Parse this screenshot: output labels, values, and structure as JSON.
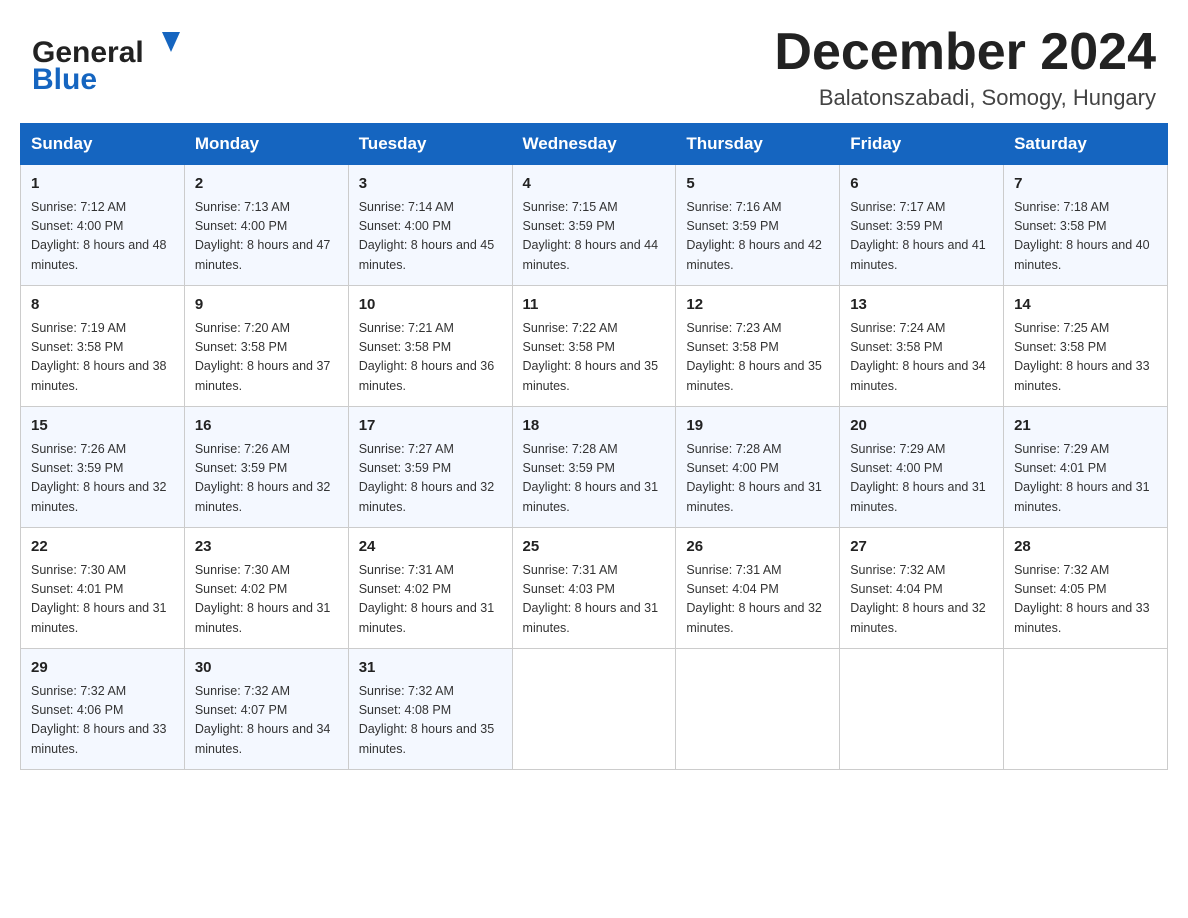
{
  "header": {
    "logo_general": "General",
    "logo_blue": "Blue",
    "month_title": "December 2024",
    "location": "Balatonszabadi, Somogy, Hungary"
  },
  "weekdays": [
    "Sunday",
    "Monday",
    "Tuesday",
    "Wednesday",
    "Thursday",
    "Friday",
    "Saturday"
  ],
  "weeks": [
    [
      {
        "day": "1",
        "sunrise": "7:12 AM",
        "sunset": "4:00 PM",
        "daylight": "8 hours and 48 minutes."
      },
      {
        "day": "2",
        "sunrise": "7:13 AM",
        "sunset": "4:00 PM",
        "daylight": "8 hours and 47 minutes."
      },
      {
        "day": "3",
        "sunrise": "7:14 AM",
        "sunset": "4:00 PM",
        "daylight": "8 hours and 45 minutes."
      },
      {
        "day": "4",
        "sunrise": "7:15 AM",
        "sunset": "3:59 PM",
        "daylight": "8 hours and 44 minutes."
      },
      {
        "day": "5",
        "sunrise": "7:16 AM",
        "sunset": "3:59 PM",
        "daylight": "8 hours and 42 minutes."
      },
      {
        "day": "6",
        "sunrise": "7:17 AM",
        "sunset": "3:59 PM",
        "daylight": "8 hours and 41 minutes."
      },
      {
        "day": "7",
        "sunrise": "7:18 AM",
        "sunset": "3:58 PM",
        "daylight": "8 hours and 40 minutes."
      }
    ],
    [
      {
        "day": "8",
        "sunrise": "7:19 AM",
        "sunset": "3:58 PM",
        "daylight": "8 hours and 38 minutes."
      },
      {
        "day": "9",
        "sunrise": "7:20 AM",
        "sunset": "3:58 PM",
        "daylight": "8 hours and 37 minutes."
      },
      {
        "day": "10",
        "sunrise": "7:21 AM",
        "sunset": "3:58 PM",
        "daylight": "8 hours and 36 minutes."
      },
      {
        "day": "11",
        "sunrise": "7:22 AM",
        "sunset": "3:58 PM",
        "daylight": "8 hours and 35 minutes."
      },
      {
        "day": "12",
        "sunrise": "7:23 AM",
        "sunset": "3:58 PM",
        "daylight": "8 hours and 35 minutes."
      },
      {
        "day": "13",
        "sunrise": "7:24 AM",
        "sunset": "3:58 PM",
        "daylight": "8 hours and 34 minutes."
      },
      {
        "day": "14",
        "sunrise": "7:25 AM",
        "sunset": "3:58 PM",
        "daylight": "8 hours and 33 minutes."
      }
    ],
    [
      {
        "day": "15",
        "sunrise": "7:26 AM",
        "sunset": "3:59 PM",
        "daylight": "8 hours and 32 minutes."
      },
      {
        "day": "16",
        "sunrise": "7:26 AM",
        "sunset": "3:59 PM",
        "daylight": "8 hours and 32 minutes."
      },
      {
        "day": "17",
        "sunrise": "7:27 AM",
        "sunset": "3:59 PM",
        "daylight": "8 hours and 32 minutes."
      },
      {
        "day": "18",
        "sunrise": "7:28 AM",
        "sunset": "3:59 PM",
        "daylight": "8 hours and 31 minutes."
      },
      {
        "day": "19",
        "sunrise": "7:28 AM",
        "sunset": "4:00 PM",
        "daylight": "8 hours and 31 minutes."
      },
      {
        "day": "20",
        "sunrise": "7:29 AM",
        "sunset": "4:00 PM",
        "daylight": "8 hours and 31 minutes."
      },
      {
        "day": "21",
        "sunrise": "7:29 AM",
        "sunset": "4:01 PM",
        "daylight": "8 hours and 31 minutes."
      }
    ],
    [
      {
        "day": "22",
        "sunrise": "7:30 AM",
        "sunset": "4:01 PM",
        "daylight": "8 hours and 31 minutes."
      },
      {
        "day": "23",
        "sunrise": "7:30 AM",
        "sunset": "4:02 PM",
        "daylight": "8 hours and 31 minutes."
      },
      {
        "day": "24",
        "sunrise": "7:31 AM",
        "sunset": "4:02 PM",
        "daylight": "8 hours and 31 minutes."
      },
      {
        "day": "25",
        "sunrise": "7:31 AM",
        "sunset": "4:03 PM",
        "daylight": "8 hours and 31 minutes."
      },
      {
        "day": "26",
        "sunrise": "7:31 AM",
        "sunset": "4:04 PM",
        "daylight": "8 hours and 32 minutes."
      },
      {
        "day": "27",
        "sunrise": "7:32 AM",
        "sunset": "4:04 PM",
        "daylight": "8 hours and 32 minutes."
      },
      {
        "day": "28",
        "sunrise": "7:32 AM",
        "sunset": "4:05 PM",
        "daylight": "8 hours and 33 minutes."
      }
    ],
    [
      {
        "day": "29",
        "sunrise": "7:32 AM",
        "sunset": "4:06 PM",
        "daylight": "8 hours and 33 minutes."
      },
      {
        "day": "30",
        "sunrise": "7:32 AM",
        "sunset": "4:07 PM",
        "daylight": "8 hours and 34 minutes."
      },
      {
        "day": "31",
        "sunrise": "7:32 AM",
        "sunset": "4:08 PM",
        "daylight": "8 hours and 35 minutes."
      },
      null,
      null,
      null,
      null
    ]
  ]
}
